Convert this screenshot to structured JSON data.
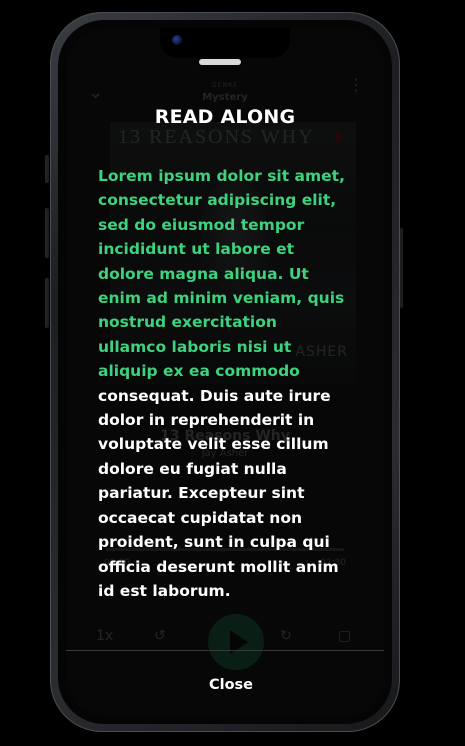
{
  "background_player": {
    "genre_label": "GENRE",
    "genre": "Mystery",
    "cover_title": "13 REASONS WHY",
    "cover_author": "ASHER",
    "track_title": "13 Reasons Why",
    "track_author": "Jay Asher",
    "time_elapsed": "00:00",
    "time_total": "02:30",
    "speed_label": "1x"
  },
  "read_along": {
    "title": "READ ALONG",
    "text_highlighted": "Lorem ipsum dolor sit amet, consectetur adipiscing elit, sed do eiusmod tempor incididunt ut labore et dolore magna aliqua. Ut enim ad minim veniam, quis nostrud exercitation ullamco laboris nisi ut aliquip ex ea commodo",
    "text_remaining": " consequat. Duis aute irure dolor in reprehenderit in voluptate velit esse cillum dolore eu fugiat nulla pariatur. Excepteur sint occaecat cupidatat non proident, sunt in culpa qui officia deserunt mollit anim id est laborum.",
    "close_label": "Close"
  },
  "colors": {
    "highlight": "#3ed17e",
    "text": "#ffffff",
    "background": "#000000",
    "accent_play": "#1fd37a"
  }
}
